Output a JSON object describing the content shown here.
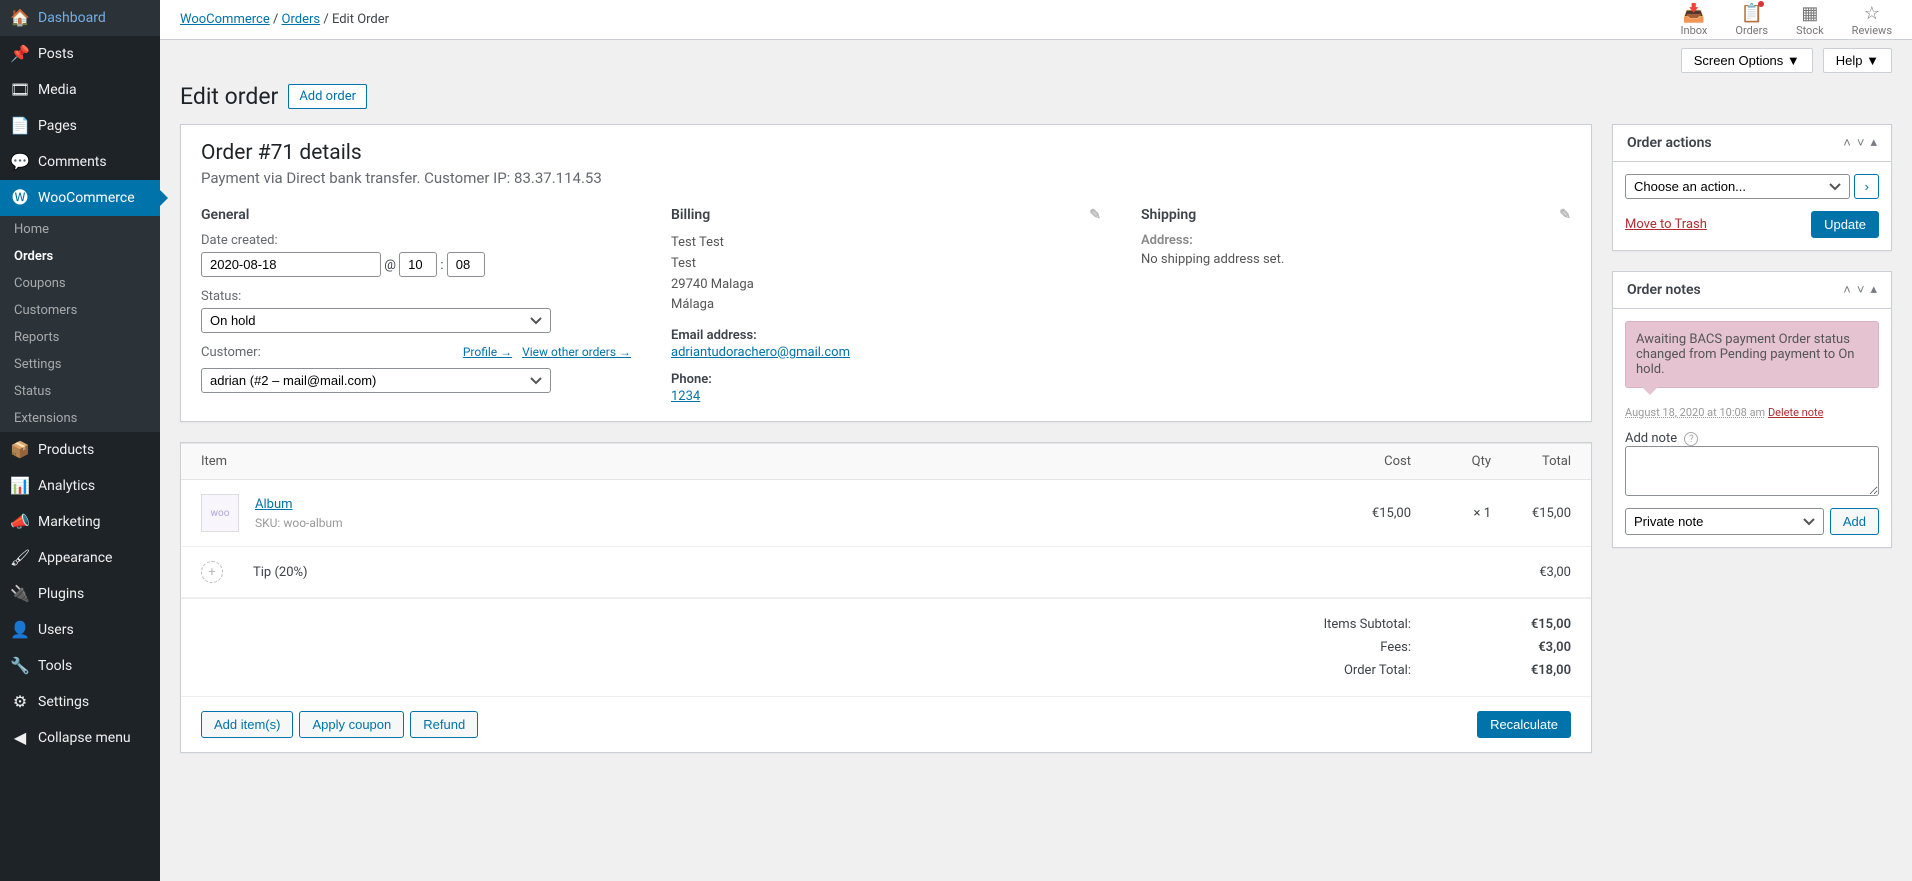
{
  "sidebar": {
    "items": [
      {
        "label": "Dashboard",
        "icon": "🏠"
      },
      {
        "label": "Posts",
        "icon": "📌"
      },
      {
        "label": "Media",
        "icon": "🎞"
      },
      {
        "label": "Pages",
        "icon": "📄"
      },
      {
        "label": "Comments",
        "icon": "💬"
      },
      {
        "label": "WooCommerce",
        "icon": "🅦",
        "active": true
      },
      {
        "label": "Products",
        "icon": "📦"
      },
      {
        "label": "Analytics",
        "icon": "📊"
      },
      {
        "label": "Marketing",
        "icon": "📣"
      },
      {
        "label": "Appearance",
        "icon": "🖌"
      },
      {
        "label": "Plugins",
        "icon": "🔌"
      },
      {
        "label": "Users",
        "icon": "👤"
      },
      {
        "label": "Tools",
        "icon": "🔧"
      },
      {
        "label": "Settings",
        "icon": "⚙"
      },
      {
        "label": "Collapse menu",
        "icon": "◀"
      }
    ],
    "submenu": [
      {
        "label": "Home"
      },
      {
        "label": "Orders",
        "active": true
      },
      {
        "label": "Coupons"
      },
      {
        "label": "Customers"
      },
      {
        "label": "Reports"
      },
      {
        "label": "Settings"
      },
      {
        "label": "Status"
      },
      {
        "label": "Extensions"
      }
    ]
  },
  "breadcrumb": {
    "a": "WooCommerce",
    "b": "Orders",
    "c": "Edit Order"
  },
  "topicons": [
    {
      "label": "Inbox",
      "glyph": "📥"
    },
    {
      "label": "Orders",
      "glyph": "📋",
      "dot": true
    },
    {
      "label": "Stock",
      "glyph": "▦"
    },
    {
      "label": "Reviews",
      "glyph": "☆"
    }
  ],
  "screenOptions": "Screen Options ▼",
  "help": "Help ▼",
  "pageTitle": "Edit order",
  "addOrder": "Add order",
  "order": {
    "title": "Order #71 details",
    "subtitle": "Payment via Direct bank transfer. Customer IP: 83.37.114.53"
  },
  "general": {
    "heading": "General",
    "dateLbl": "Date created:",
    "date": "2020-08-18",
    "at": "@",
    "hour": "10",
    "min": "08",
    "sep": ":",
    "statusLbl": "Status:",
    "status": "On hold",
    "custLbl": "Customer:",
    "profile": "Profile →",
    "viewOther": "View other orders →",
    "customer": "adrian (#2 – mail@mail.com)"
  },
  "billing": {
    "heading": "Billing",
    "name": "Test Test",
    "line2": "Test",
    "line3": "29740 Malaga",
    "line4": "Málaga",
    "emailLbl": "Email address:",
    "email": "adriantudorachero@gmail.com",
    "phoneLbl": "Phone:",
    "phone": "1234"
  },
  "shipping": {
    "heading": "Shipping",
    "addrLbl": "Address:",
    "noAddr": "No shipping address set."
  },
  "itemsHead": {
    "item": "Item",
    "cost": "Cost",
    "qty": "Qty",
    "total": "Total"
  },
  "items": [
    {
      "name": "Album",
      "skuLbl": "SKU:",
      "sku": "woo-album",
      "cost": "€15,00",
      "qty": "× 1",
      "total": "€15,00"
    }
  ],
  "fee": {
    "name": "Tip (20%)",
    "total": "€3,00"
  },
  "totals": {
    "subLbl": "Items Subtotal:",
    "sub": "€15,00",
    "feeLbl": "Fees:",
    "fee": "€3,00",
    "totLbl": "Order Total:",
    "tot": "€18,00"
  },
  "itemActions": {
    "add": "Add item(s)",
    "coupon": "Apply coupon",
    "refund": "Refund",
    "recalc": "Recalculate"
  },
  "orderActions": {
    "heading": "Order actions",
    "choose": "Choose an action...",
    "trash": "Move to Trash",
    "update": "Update"
  },
  "orderNotes": {
    "heading": "Order notes",
    "noteText": "Awaiting BACS payment Order status changed from Pending payment to On hold.",
    "noteTime": "August 18, 2020 at 10:08 am",
    "delete": "Delete note",
    "addLbl": "Add note",
    "noteType": "Private note",
    "addBtn": "Add"
  }
}
